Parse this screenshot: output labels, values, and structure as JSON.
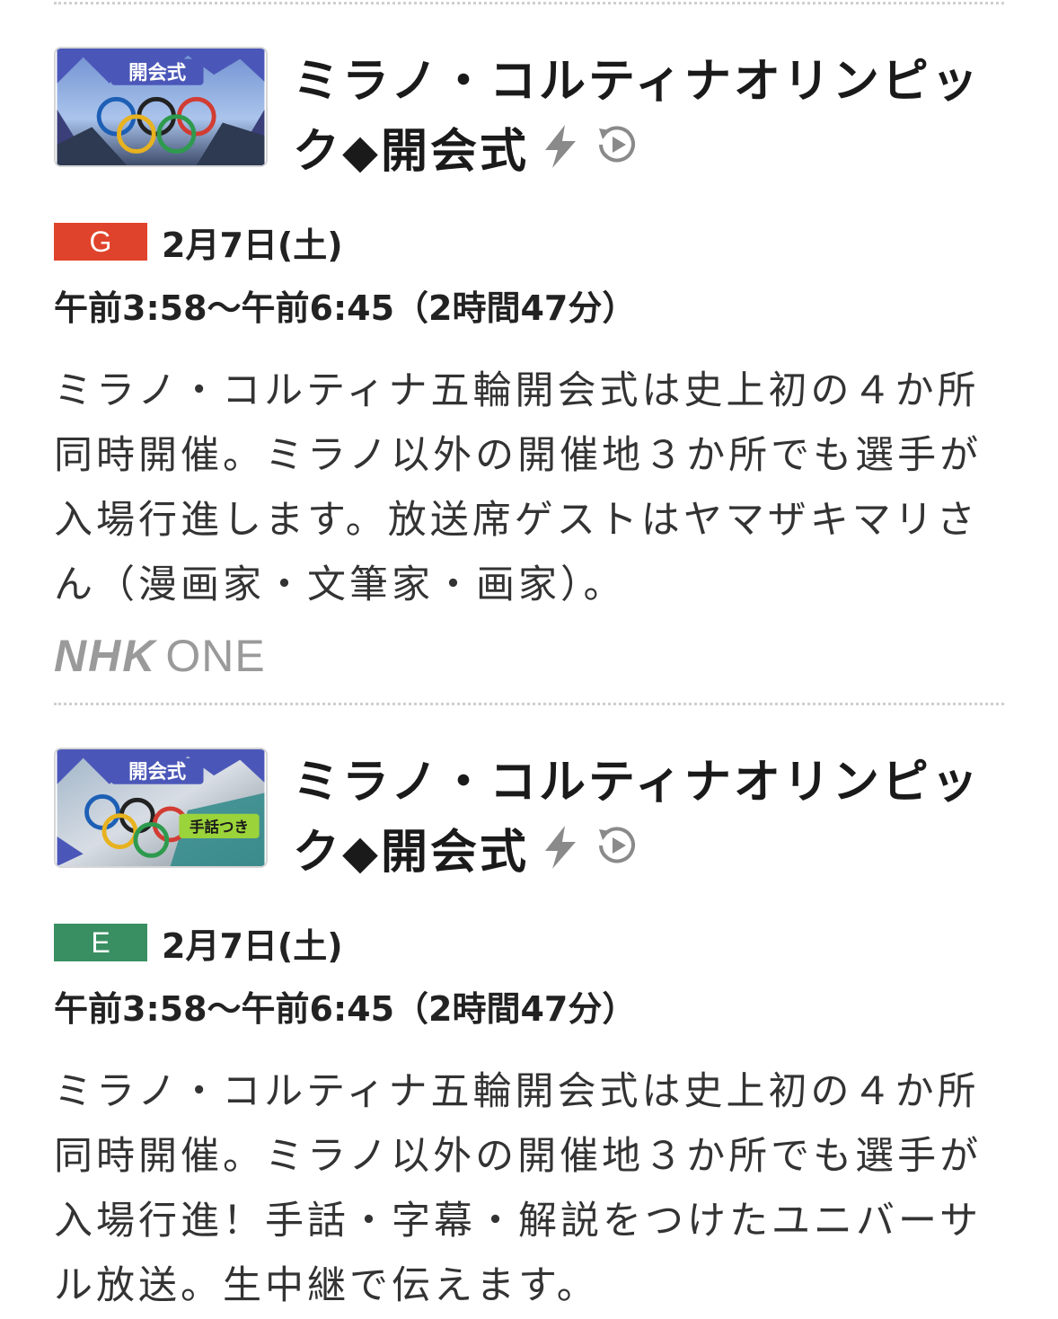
{
  "programs": [
    {
      "thumb_label": "開会式",
      "thumb_badge": "",
      "title": "ミラノ・コルティナオリンピック◆開会式",
      "channel": "G",
      "channel_color": "#e0432b",
      "date": "2月7日(土)",
      "time": "午前3:58〜午前6:45（2時間47分）",
      "description": "ミラノ・コルティナ五輪開会式は史上初の４か所同時開催。ミラノ以外の開催地３か所でも選手が入場行進します。放送席ゲストはヤマザキマリさん（漫画家・文筆家・画家）。",
      "service_logo": {
        "nhk": "NHK",
        "one": "ONE"
      },
      "icons": [
        "lightning-icon",
        "replay-play-icon"
      ]
    },
    {
      "thumb_label": "開会式",
      "thumb_badge": "手話つき",
      "title": "ミラノ・コルティナオリンピック◆開会式",
      "channel": "E",
      "channel_color": "#3a8f62",
      "date": "2月7日(土)",
      "time": "午前3:58〜午前6:45（2時間47分）",
      "description": "ミラノ・コルティナ五輪開会式は史上初の４か所同時開催。ミラノ以外の開催地３か所でも選手が入場行進！手話・字幕・解説をつけたユニバーサル放送。生中継で伝えます。",
      "icons": [
        "lightning-icon",
        "replay-play-icon"
      ]
    }
  ]
}
